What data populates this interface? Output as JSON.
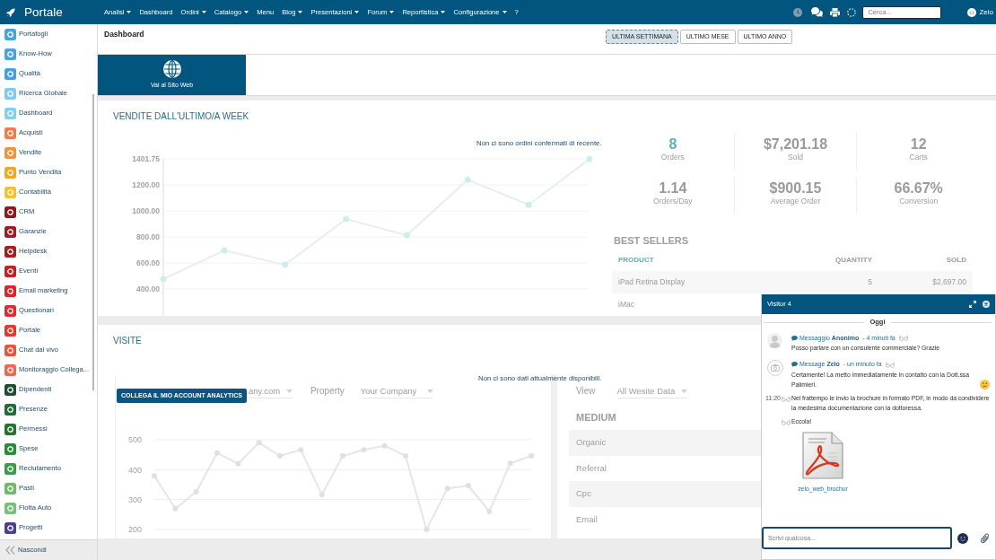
{
  "navbar": {
    "brand": "Portale",
    "menu": [
      {
        "label": "Analisi",
        "dropdown": true
      },
      {
        "label": "Dashboard",
        "dropdown": false
      },
      {
        "label": "Ordini",
        "dropdown": true
      },
      {
        "label": "Catalogo",
        "dropdown": true
      },
      {
        "label": "Menu",
        "dropdown": false
      },
      {
        "label": "Blog",
        "dropdown": true
      },
      {
        "label": "Presentazioni",
        "dropdown": true
      },
      {
        "label": "Forum",
        "dropdown": true
      },
      {
        "label": "Reportistica",
        "dropdown": true
      },
      {
        "label": "Configurazione",
        "dropdown": true
      },
      {
        "label": "?",
        "dropdown": false
      }
    ],
    "search": {
      "placeholder": "Cerca..."
    },
    "user": "Zelo"
  },
  "sidebar": {
    "items": [
      {
        "label": "Portafogli",
        "color": "#4aa3df"
      },
      {
        "label": "Know-How",
        "color": "#4aa3df"
      },
      {
        "label": "Qualità",
        "color": "#45a2e0"
      },
      {
        "label": "Ricerca Globale",
        "color": "#7fcaf0"
      },
      {
        "label": "Dashboard",
        "color": "#83d0f2"
      },
      {
        "label": "Acquisti",
        "color": "#ee7d4b"
      },
      {
        "label": "Vendite",
        "color": "#ef9440"
      },
      {
        "label": "Punto Vendita",
        "color": "#f5a623"
      },
      {
        "label": "Contabilità",
        "color": "#fbc02d"
      },
      {
        "label": "CRM",
        "color": "#8e1b1b"
      },
      {
        "label": "Garanzie",
        "color": "#9b2121"
      },
      {
        "label": "Helpdesk",
        "color": "#a61e1e"
      },
      {
        "label": "Eventi",
        "color": "#bf2227"
      },
      {
        "label": "Email marketing",
        "color": "#d6272d"
      },
      {
        "label": "Questionari",
        "color": "#dc2e2e"
      },
      {
        "label": "Portale",
        "color": "#e23a2c"
      },
      {
        "label": "Chat dal vivo",
        "color": "#e8553a"
      },
      {
        "label": "Monitoraggio Collega...",
        "color": "#ec6a4f"
      },
      {
        "label": "Dipendenti",
        "color": "#1f4f33"
      },
      {
        "label": "Presenze",
        "color": "#236b35"
      },
      {
        "label": "Permessi",
        "color": "#247332"
      },
      {
        "label": "Spese",
        "color": "#2d8a3b"
      },
      {
        "label": "Reclutamento",
        "color": "#3d9c48"
      },
      {
        "label": "Pasti",
        "color": "#6fbb6b"
      },
      {
        "label": "Flotta Auto",
        "color": "#79c17b"
      },
      {
        "label": "Progetti",
        "color": "#4f3f8f"
      }
    ],
    "hide_label": "Nascondi"
  },
  "header": {
    "title": "Dashboard",
    "periods": [
      {
        "label": "ULTIMA SETTIMANA",
        "selected": true
      },
      {
        "label": "ULTIMO MESE",
        "selected": false
      },
      {
        "label": "ULTIMO ANNO",
        "selected": false
      }
    ]
  },
  "shortcut": {
    "label": "Vai al Sito Web"
  },
  "sales": {
    "title": "VENDITE DALL'ULTIMO/A WEEK",
    "notice": "Non ci sono ordini confermati di recente.",
    "chart_data": {
      "type": "line",
      "ylim": [
        193,
        1401.75
      ],
      "yticks": [
        {
          "value": 1401.75,
          "label": "1401.75"
        },
        {
          "value": 1200,
          "label": "1200.00"
        },
        {
          "value": 1000,
          "label": "1000.00"
        },
        {
          "value": 800,
          "label": "800.00"
        },
        {
          "value": 600,
          "label": "600.00"
        },
        {
          "value": 400,
          "label": "400.00"
        }
      ],
      "grid": true,
      "series": [
        {
          "color": "#e8eeee",
          "marker": "circle",
          "values": [
            476,
            697,
            586,
            938,
            814,
            1241,
            1048,
            1400
          ]
        }
      ]
    },
    "stats": [
      {
        "value": "8",
        "label": "Orders"
      },
      {
        "value": "$7,201.18",
        "label": "Sold"
      },
      {
        "value": "12",
        "label": "Carts"
      },
      {
        "value": "1.14",
        "label": "Orders/Day"
      },
      {
        "value": "$900.15",
        "label": "Average Order"
      },
      {
        "value": "66.67%",
        "label": "Conversion"
      }
    ],
    "best_sellers": {
      "title": "BEST SELLERS",
      "columns": [
        "PRODUCT",
        "QUANTITY",
        "SOLD"
      ],
      "rows": [
        [
          "iPad Retina Display",
          "5",
          "$2,697.00"
        ],
        [
          "iMac"
        ]
      ]
    }
  },
  "visits": {
    "title": "VISITE",
    "notice": "Non ci sono dati attualmente disponibili.",
    "connect_button": "COLLEGA IL MIO ACCOUNT ANALYTICS",
    "filters": [
      {
        "value": "any.com"
      },
      {
        "label": "Property",
        "value": "Your Company"
      }
    ],
    "chart_data": {
      "type": "line",
      "ylim": [
        200,
        500
      ],
      "yticks": [
        500,
        400,
        300,
        200
      ],
      "grid": true,
      "series": [
        {
          "color": "#e6e6e6",
          "marker": "circle",
          "values": [
            379,
            270,
            326,
            456,
            420,
            490,
            446,
            466,
            316,
            446,
            466,
            480,
            446,
            200,
            337,
            346,
            260,
            421,
            446
          ]
        }
      ]
    },
    "view": {
      "label": "View",
      "value": "All Wesite Data"
    },
    "medium": {
      "title": "MEDIUM",
      "rows": [
        "Organic",
        "Referral",
        "Cpc",
        "Email"
      ]
    }
  },
  "chat": {
    "title": "Visitor 4",
    "day": "Oggi",
    "messages": [
      {
        "kind": "visitor",
        "label": "Messaggio",
        "author": "Anonimo",
        "time": "- 4 minuti fa",
        "text": "Posso parlare con un consulente commerciale? Grazie"
      },
      {
        "kind": "agent",
        "label": "Message",
        "author": "Zelo",
        "time": "- un minuto fa",
        "text": "Certamente! La metto immediatamente in contatto con la Dott.ssa Palimieri.",
        "emoji": true
      },
      {
        "kind": "followup",
        "time": "11:20",
        "text": "Nel frattempo le invio la brochure in formato PDF, in modo da condividere la medesima documentazione con la dottoressa."
      },
      {
        "kind": "followup",
        "text": "Eccola!"
      },
      {
        "kind": "file",
        "name": "zelo_web_brochur"
      }
    ],
    "input": {
      "placeholder": "Scrivi qualcosa..."
    }
  }
}
